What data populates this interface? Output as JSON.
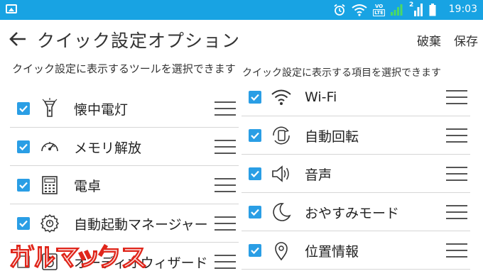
{
  "status_bar": {
    "time": "19:03",
    "volte": "VO",
    "lte": "LTE",
    "sim_index": "2",
    "icons": [
      "gallery-notification-icon",
      "alarm-icon",
      "wifi-icon",
      "volte-icon",
      "signal-icon",
      "signal-2-icon",
      "battery-icon"
    ]
  },
  "header": {
    "title": "クイック設定オプション",
    "discard_label": "破棄",
    "save_label": "保存"
  },
  "left_panel": {
    "description": "クイック設定に表示するツールを選択できます",
    "items": [
      {
        "label": "懐中電灯",
        "checked": true,
        "icon": "flashlight-icon"
      },
      {
        "label": "メモリ解放",
        "checked": true,
        "icon": "speedometer-icon"
      },
      {
        "label": "電卓",
        "checked": true,
        "icon": "calculator-icon"
      },
      {
        "label": "自動起動マネージャー",
        "checked": true,
        "icon": "gear-icon"
      },
      {
        "label": "オーディオウィザード",
        "checked": false,
        "icon": "audio-wizard-icon"
      }
    ]
  },
  "right_panel": {
    "description": "クイック設定に表示する項目を選択できます",
    "items": [
      {
        "label": "Wi-Fi",
        "checked": true,
        "icon": "wifi-icon"
      },
      {
        "label": "自動回転",
        "checked": true,
        "icon": "auto-rotate-icon"
      },
      {
        "label": "音声",
        "checked": true,
        "icon": "speaker-icon"
      },
      {
        "label": "おやすみモード",
        "checked": true,
        "icon": "moon-icon"
      },
      {
        "label": "位置情報",
        "checked": true,
        "icon": "location-pin-icon"
      }
    ]
  },
  "watermark": {
    "text": "ガルマックス"
  },
  "colors": {
    "status_bar": "#18a3e3",
    "checkbox": "#2a9ee5",
    "divider": "#d6d6d6",
    "watermark": "#e0261b"
  }
}
